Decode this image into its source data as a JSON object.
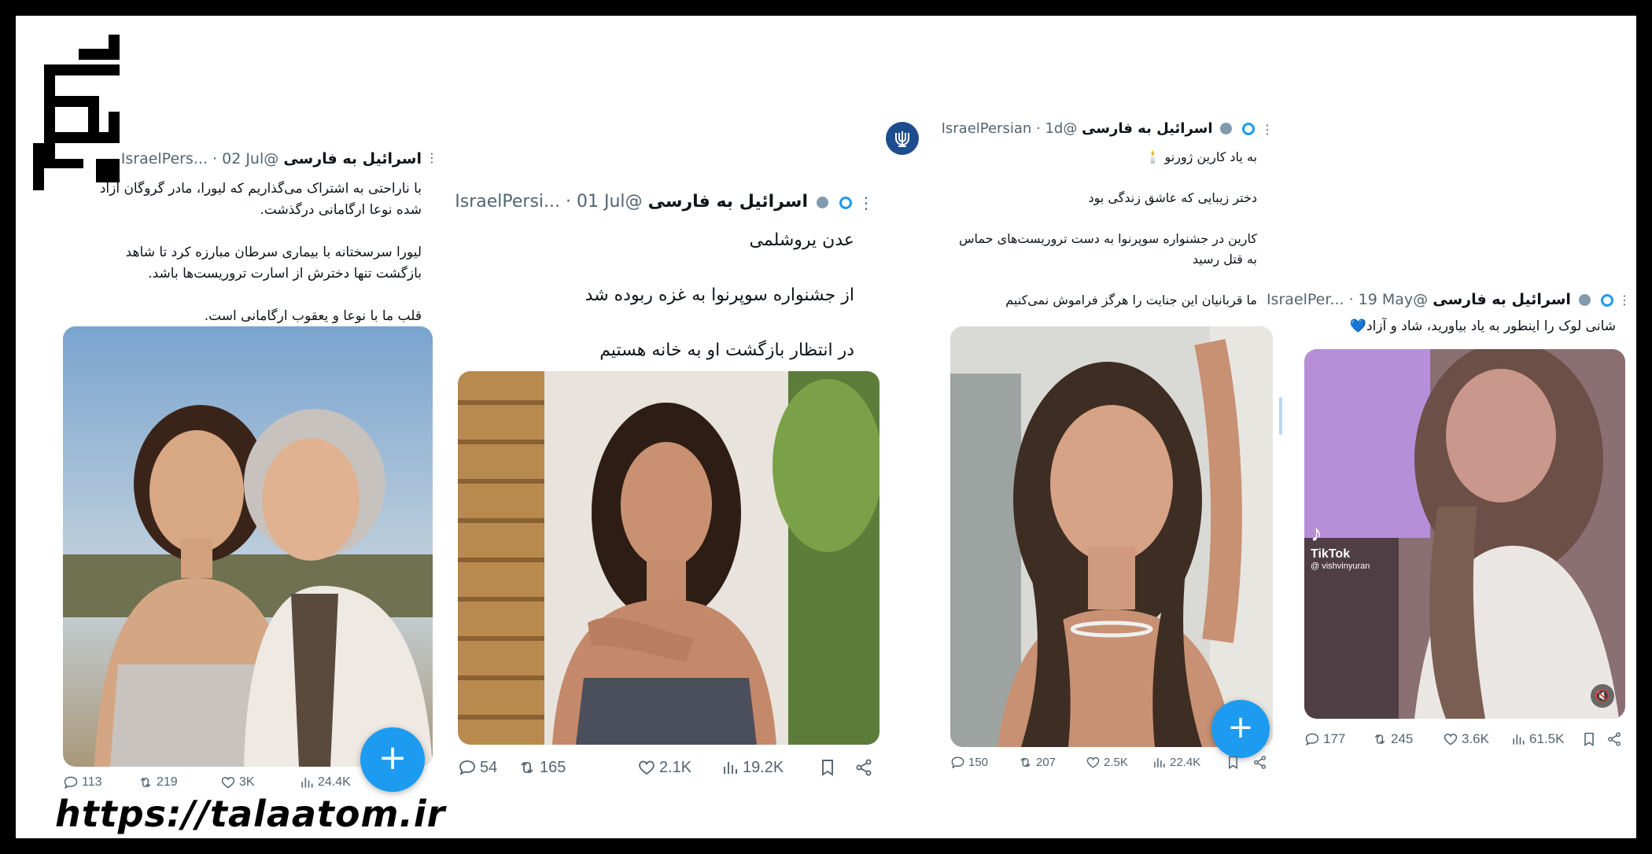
{
  "watermark_url": "https://talaatom.ir",
  "posts": [
    {
      "name": "اسرائیل به فارسی",
      "handle": "@IsraelPers...",
      "date": "· 02 Jul",
      "lines": [
        "با ناراحتی به اشتراک می‌گذاریم که لیورا، مادر گروگان آزاد",
        "شده نوعا ارگامانی درگذشت.",
        "",
        "لیورا سرسختانه با بیماری سرطان مبارزه کرد تا شاهد",
        "بازگشت تنها دخترش از اسارت تروریست‌ها باشد.",
        "",
        "قلب ما با نوعا و یعقوب ارگامانی است."
      ],
      "replies": "113",
      "reposts": "219",
      "likes": "3K",
      "views": "24.4K"
    },
    {
      "name": "اسرائیل به فارسی",
      "handle": "@IsraelPersi...",
      "date": "· 01 Jul",
      "lines": [
        "عدن یروشلمی",
        "",
        "از جشنواره سوپرنوا به غزه ربوده شد",
        "",
        "در انتظار بازگشت او به خانه هستیم"
      ],
      "replies": "54",
      "reposts": "165",
      "likes": "2.1K",
      "views": "19.2K"
    },
    {
      "name": "اسرائیل به فارسی",
      "handle": "@IsraelPersian",
      "date": "· 1d",
      "lines": [
        "به یاد کارین ژورنو 🕯️",
        "",
        "دختر زیبایی که عاشق زندگی بود",
        "",
        "کارین در جشنواره سوپرنوا به دست تروریست‌های حماس",
        "به قتل رسید",
        "",
        "ما قربانیان این جنایت را هرگز فراموش نمی‌کنیم"
      ],
      "replies": "150",
      "reposts": "207",
      "likes": "2.5K",
      "views": "22.4K"
    },
    {
      "name": "اسرائیل به فارسی",
      "handle": "@IsraelPer...",
      "date": "· 19 May",
      "lines": [
        "شانی لوک را اینطور به یاد بیاورید، شاد و آزاد💙"
      ],
      "replies": "177",
      "reposts": "245",
      "likes": "3.6K",
      "views": "61.5K",
      "video_overlay": "TikTok",
      "video_user": "@ vishvinyuran"
    }
  ],
  "colors": {
    "accent": "#1d9bf0",
    "text": "#0f1419",
    "muted": "#536471"
  },
  "icons": [
    "more-icon",
    "verified-icon",
    "reply-icon",
    "repost-icon",
    "like-icon",
    "views-icon",
    "bookmark-icon",
    "share-icon",
    "plus-icon",
    "mute-icon"
  ]
}
